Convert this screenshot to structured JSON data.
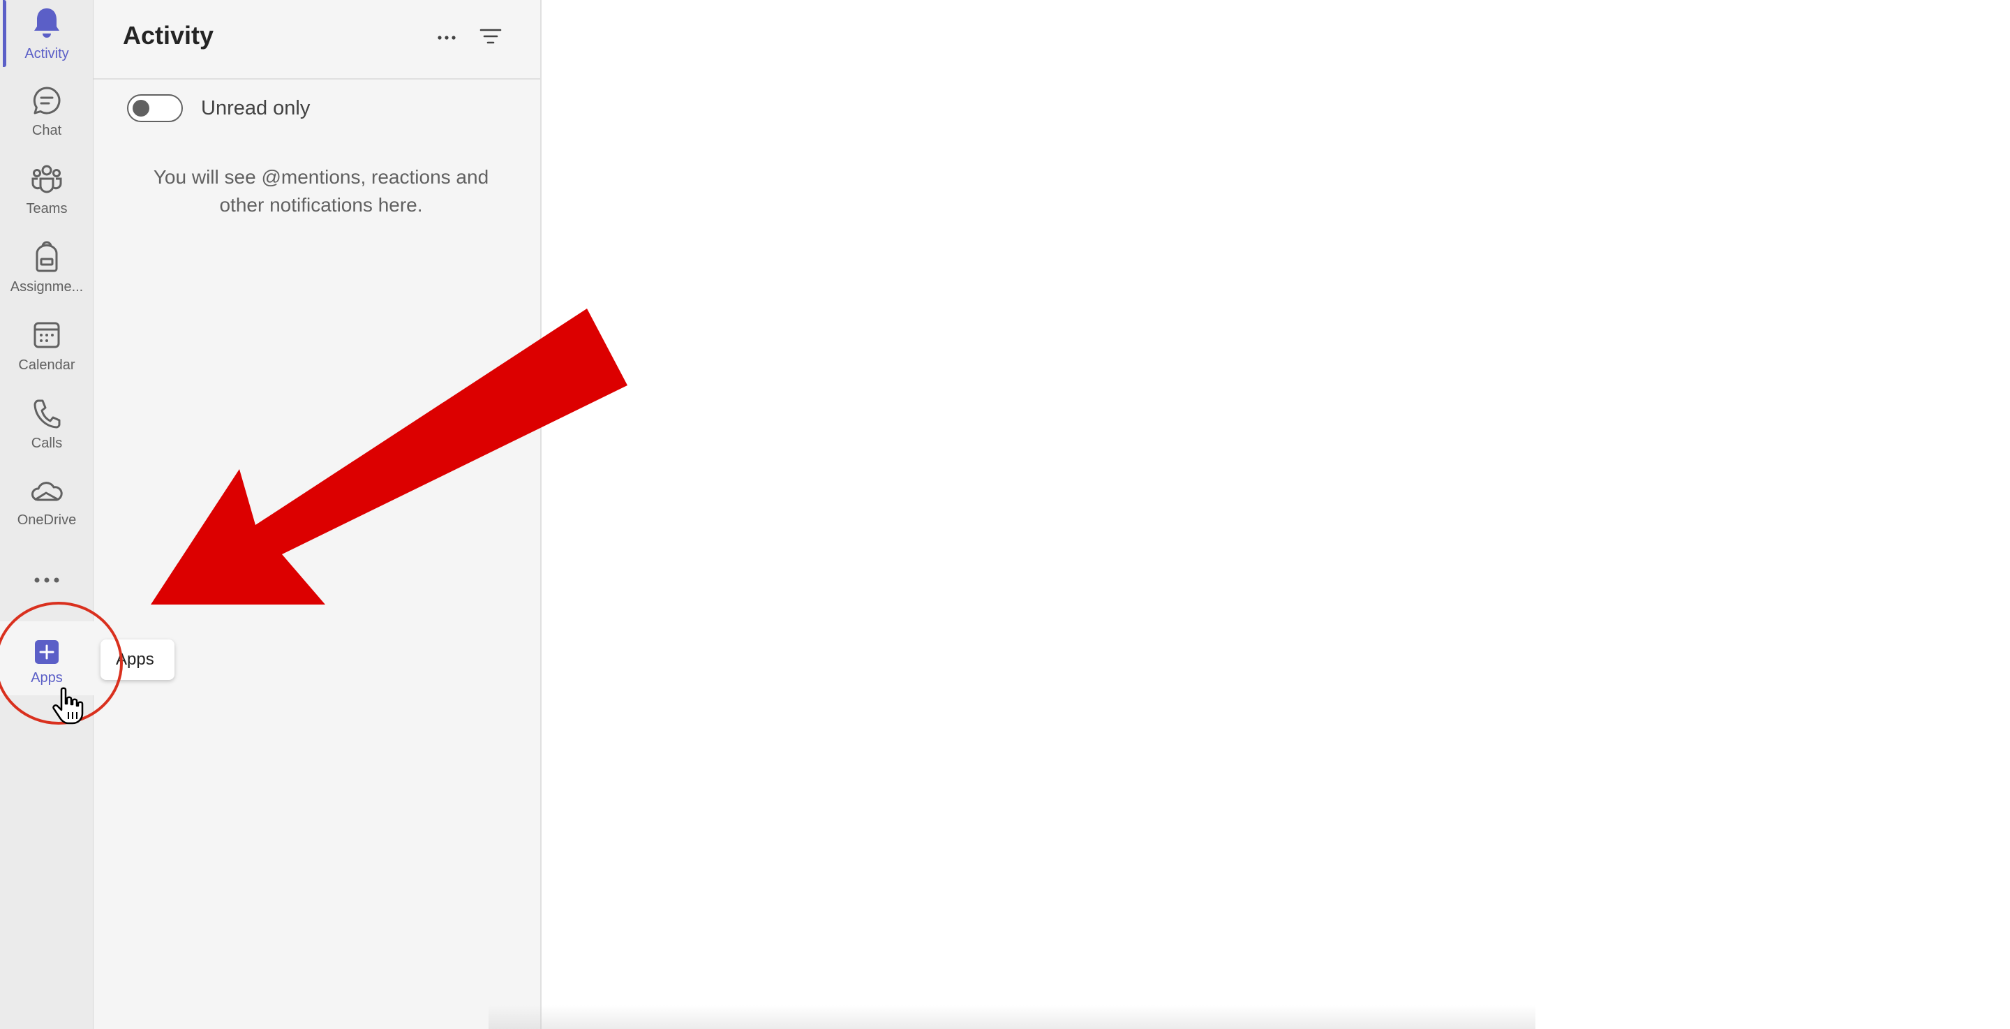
{
  "rail": {
    "items": [
      {
        "label": "Activity",
        "icon": "bell-icon"
      },
      {
        "label": "Chat",
        "icon": "chat-icon"
      },
      {
        "label": "Teams",
        "icon": "teams-icon"
      },
      {
        "label": "Assignme...",
        "icon": "backpack-icon"
      },
      {
        "label": "Calendar",
        "icon": "calendar-icon"
      },
      {
        "label": "Calls",
        "icon": "phone-icon"
      },
      {
        "label": "OneDrive",
        "icon": "cloud-icon"
      }
    ],
    "more_icon": "ellipsis-icon",
    "apps": {
      "label": "Apps",
      "icon": "add-apps-icon"
    }
  },
  "panel": {
    "title": "Activity",
    "more_icon": "ellipsis-icon",
    "filter_icon": "filter-icon",
    "toggle_label": "Unread only",
    "toggle_on": false,
    "empty_message": "You will see @mentions, reactions and other notifications here."
  },
  "tooltip": {
    "text": "Apps"
  },
  "colors": {
    "accent": "#5b5fc7",
    "annotation_red": "#dc0000",
    "circle_red": "#d9301e"
  }
}
